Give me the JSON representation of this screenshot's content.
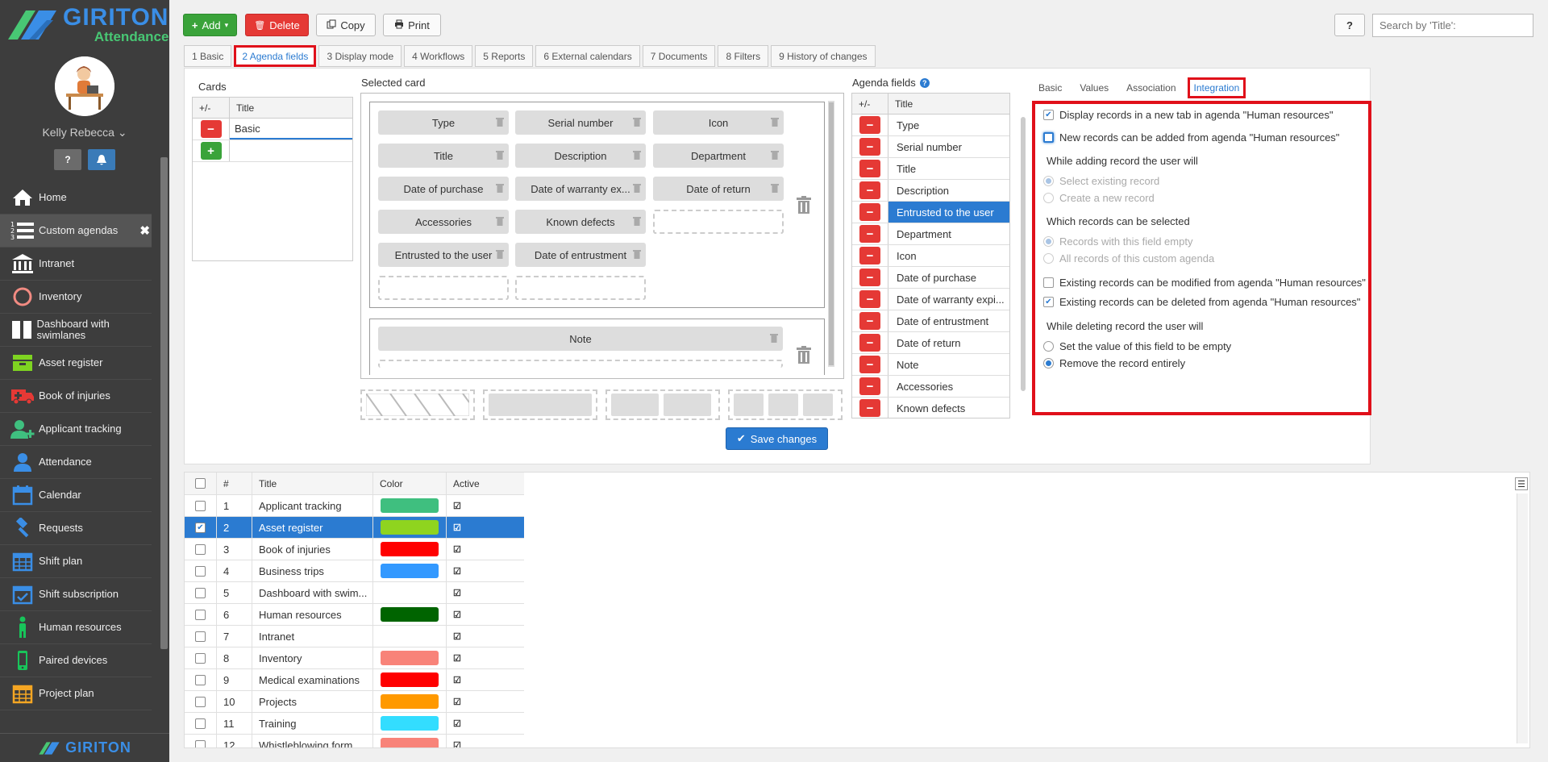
{
  "brand": {
    "name": "GIRITON",
    "product": "Attendance",
    "colors": {
      "blue": "#3a8ee6",
      "green": "#48c774",
      "accent": "#2b7bd1",
      "danger": "#e53935",
      "success": "#3aa33a"
    }
  },
  "user": {
    "name": "Kelly Rebecca"
  },
  "sidebar": {
    "items": [
      {
        "label": "Home",
        "icon": "home-icon",
        "color": "#ffffff"
      },
      {
        "label": "Custom agendas",
        "icon": "list-numbered-icon",
        "color": "#ffffff",
        "active": true
      },
      {
        "label": "Intranet",
        "icon": "bank-icon",
        "color": "#ffffff"
      },
      {
        "label": "Inventory",
        "icon": "circle-icon",
        "color": "#f28b82"
      },
      {
        "label": "Dashboard with swimlanes",
        "icon": "columns-icon",
        "color": "#ffffff"
      },
      {
        "label": "Asset register",
        "icon": "folder-icon",
        "color": "#7ed321"
      },
      {
        "label": "Book of injuries",
        "icon": "ambulance-icon",
        "color": "#e53935"
      },
      {
        "label": "Applicant tracking",
        "icon": "user-plus-icon",
        "color": "#3fbf7f"
      },
      {
        "label": "Attendance",
        "icon": "user-icon",
        "color": "#3a8ee6"
      },
      {
        "label": "Calendar",
        "icon": "calendar-icon",
        "color": "#3a8ee6"
      },
      {
        "label": "Requests",
        "icon": "gavel-icon",
        "color": "#3a8ee6"
      },
      {
        "label": "Shift plan",
        "icon": "calendar-grid-icon",
        "color": "#3a8ee6"
      },
      {
        "label": "Shift subscription",
        "icon": "calendar-check-icon",
        "color": "#3a8ee6"
      },
      {
        "label": "Human resources",
        "icon": "person-standing-icon",
        "color": "#18c45a"
      },
      {
        "label": "Paired devices",
        "icon": "mobile-icon",
        "color": "#18c45a"
      },
      {
        "label": "Project plan",
        "icon": "calendar-orange-icon",
        "color": "#f5a623"
      }
    ]
  },
  "toolbar": {
    "add": "Add",
    "delete": "Delete",
    "copy": "Copy",
    "print": "Print",
    "help": "?",
    "search_placeholder": "Search by 'Title':"
  },
  "tabs": [
    {
      "label": "1 Basic"
    },
    {
      "label": "2 Agenda fields",
      "active": true
    },
    {
      "label": "3 Display mode"
    },
    {
      "label": "4 Workflows"
    },
    {
      "label": "5 Reports"
    },
    {
      "label": "6 External calendars"
    },
    {
      "label": "7 Documents"
    },
    {
      "label": "8 Filters"
    },
    {
      "label": "9 History of changes"
    }
  ],
  "cards": {
    "title": "Cards",
    "col_pm": "+/-",
    "col_title": "Title",
    "rows": [
      {
        "title": "Basic"
      }
    ]
  },
  "selected_card": {
    "title": "Selected card",
    "fields": [
      "Type",
      "Serial number",
      "Icon",
      "Title",
      "Description",
      "Department",
      "Date of purchase",
      "Date of warranty ex...",
      "Date of return",
      "Accessories",
      "Known defects",
      "Entrusted to the user",
      "Date of entrustment"
    ],
    "note_field": "Note"
  },
  "save": {
    "label": "Save changes"
  },
  "agenda_fields": {
    "title": "Agenda fields",
    "col_pm": "+/-",
    "col_title": "Title",
    "rows": [
      "Type",
      "Serial number",
      "Title",
      "Description",
      "Entrusted to the user",
      "Department",
      "Icon",
      "Date of purchase",
      "Date of warranty expi...",
      "Date of entrustment",
      "Date of return",
      "Note",
      "Accessories",
      "Known defects"
    ],
    "selected_index": 4
  },
  "settings_tabs": [
    {
      "label": "Basic"
    },
    {
      "label": "Values"
    },
    {
      "label": "Association"
    },
    {
      "label": "Integration",
      "active": true
    }
  ],
  "integration": {
    "display_new_tab": {
      "label": "Display records in a new tab in agenda \"Human resources\"",
      "checked": true
    },
    "new_records": {
      "label": "New records can be added from agenda \"Human resources\"",
      "checked": false
    },
    "adding_heading": "While adding record the user will",
    "adding_opt1": "Select existing record",
    "adding_opt2": "Create a new record",
    "which_heading": "Which records can be selected",
    "which_opt1": "Records with this field empty",
    "which_opt2": "All records of this custom agenda",
    "modify": {
      "label": "Existing records can be modified from agenda \"Human resources\"",
      "checked": false
    },
    "delete": {
      "label": "Existing records can be deleted from agenda \"Human resources\"",
      "checked": true
    },
    "deleting_heading": "While deleting record the user will",
    "deleting_opt1": "Set the value of this field to be empty",
    "deleting_opt2": "Remove the record entirely"
  },
  "grid": {
    "headers": {
      "num": "#",
      "title": "Title",
      "color": "Color",
      "active": "Active"
    },
    "rows": [
      {
        "num": "1",
        "title": "Applicant tracking",
        "color": "#3fbf7f"
      },
      {
        "num": "2",
        "title": "Asset register",
        "color": "#8fd41f",
        "selected": true
      },
      {
        "num": "3",
        "title": "Book of injuries",
        "color": "#ff0000"
      },
      {
        "num": "4",
        "title": "Business trips",
        "color": "#3399ff"
      },
      {
        "num": "5",
        "title": "Dashboard with swim...",
        "color": ""
      },
      {
        "num": "6",
        "title": "Human resources",
        "color": "#006400"
      },
      {
        "num": "7",
        "title": "Intranet",
        "color": ""
      },
      {
        "num": "8",
        "title": "Inventory",
        "color": "#f88379"
      },
      {
        "num": "9",
        "title": "Medical examinations",
        "color": "#ff0000"
      },
      {
        "num": "10",
        "title": "Projects",
        "color": "#ff9900"
      },
      {
        "num": "11",
        "title": "Training",
        "color": "#33ddff"
      },
      {
        "num": "12",
        "title": "Whistleblowing form...",
        "color": "#f88379"
      }
    ]
  }
}
